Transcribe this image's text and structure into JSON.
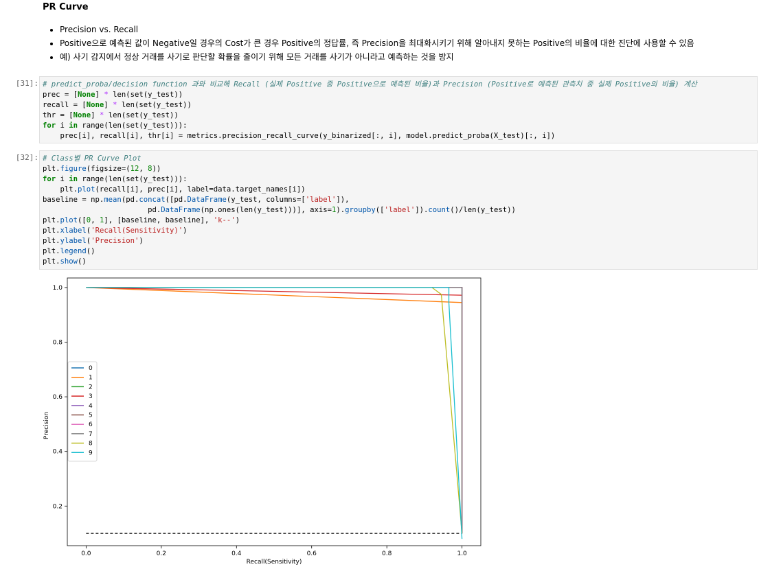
{
  "markdown": {
    "heading": "PR Curve",
    "bullets": [
      "Precision vs. Recall",
      "Positive으로 예측된 값이 Negative일 경우의 Cost가 큰 경우 Positive의 정답률, 즉 Precision을 최대화시키기 위해 알아내지 못하는 Positive의 비율에 대한 진단에 사용할 수 있음",
      "예) 사기 감지에서 정상 거래를 사기로 판단할 확률을 줄이기 위해 모든 거래를 사기가 아니라고 예측하는 것을 방지"
    ]
  },
  "cells": [
    {
      "prompt": "[31]:",
      "lines": [
        [
          [
            "cm",
            "# predict_proba/decision function 과와 비교해 Recall (실제 Positive 중 Positive으로 예측된 비율)과 Precision (Positive로 예측된 관측치 중 실제 Positive의 비율) 계산"
          ]
        ],
        [
          [
            "",
            "prec = ["
          ],
          [
            "kw",
            "None"
          ],
          [
            "",
            "] "
          ],
          [
            "op",
            "*"
          ],
          [
            "",
            " len(set(y_test))"
          ]
        ],
        [
          [
            "",
            "recall = ["
          ],
          [
            "kw",
            "None"
          ],
          [
            "",
            "] "
          ],
          [
            "op",
            "*"
          ],
          [
            "",
            " len(set(y_test))"
          ]
        ],
        [
          [
            "",
            "thr = ["
          ],
          [
            "kw",
            "None"
          ],
          [
            "",
            "] "
          ],
          [
            "op",
            "*"
          ],
          [
            "",
            " len(set(y_test))"
          ]
        ],
        [
          [
            "kw",
            "for"
          ],
          [
            "",
            " i "
          ],
          [
            "kw",
            "in"
          ],
          [
            "",
            " range(len(set(y_test))):"
          ]
        ],
        [
          [
            "",
            "    prec[i], recall[i], thr[i] = metrics.precision_recall_curve(y_binarized[:, i], model.predict_proba(X_test)[:, i])"
          ]
        ]
      ]
    },
    {
      "prompt": "[32]:",
      "lines": [
        [
          [
            "cm",
            "# Class별 PR Curve Plot"
          ]
        ],
        [
          [
            "",
            "plt."
          ],
          [
            "attr",
            "figure"
          ],
          [
            "",
            "(figsize=("
          ],
          [
            "num",
            "12"
          ],
          [
            "",
            ", "
          ],
          [
            "num",
            "8"
          ],
          [
            "",
            "))"
          ]
        ],
        [
          [
            "kw",
            "for"
          ],
          [
            "",
            " i "
          ],
          [
            "kw",
            "in"
          ],
          [
            "",
            " range(len(set(y_test))):"
          ]
        ],
        [
          [
            "",
            "    plt."
          ],
          [
            "attr",
            "plot"
          ],
          [
            "",
            "(recall[i], prec[i], label=data.target_names[i])"
          ]
        ],
        [
          [
            "",
            "baseline = np."
          ],
          [
            "attr",
            "mean"
          ],
          [
            "",
            "(pd."
          ],
          [
            "attr",
            "concat"
          ],
          [
            "",
            "([pd."
          ],
          [
            "attr",
            "DataFrame"
          ],
          [
            "",
            "(y_test, columns=["
          ],
          [
            "str",
            "'label'"
          ],
          [
            "",
            "]),"
          ]
        ],
        [
          [
            "",
            "                        pd."
          ],
          [
            "attr",
            "DataFrame"
          ],
          [
            "",
            "(np.ones(len(y_test)))], axis="
          ],
          [
            "num",
            "1"
          ],
          [
            "",
            ")."
          ],
          [
            "attr",
            "groupby"
          ],
          [
            "",
            "(["
          ],
          [
            "str",
            "'label'"
          ],
          [
            "",
            "])."
          ],
          [
            "attr",
            "count"
          ],
          [
            "",
            "()/len(y_test))"
          ]
        ],
        [
          [
            "",
            "plt."
          ],
          [
            "attr",
            "plot"
          ],
          [
            "",
            "(["
          ],
          [
            "num",
            "0"
          ],
          [
            "",
            ", "
          ],
          [
            "num",
            "1"
          ],
          [
            "",
            "], [baseline, baseline], "
          ],
          [
            "str",
            "'k--'"
          ],
          [
            "",
            ")"
          ]
        ],
        [
          [
            "",
            "plt."
          ],
          [
            "attr",
            "xlabel"
          ],
          [
            "",
            "("
          ],
          [
            "str",
            "'Recall(Sensitivity)'"
          ],
          [
            "",
            ")"
          ]
        ],
        [
          [
            "",
            "plt."
          ],
          [
            "attr",
            "ylabel"
          ],
          [
            "",
            "("
          ],
          [
            "str",
            "'Precision'"
          ],
          [
            "",
            ")"
          ]
        ],
        [
          [
            "",
            "plt."
          ],
          [
            "attr",
            "legend"
          ],
          [
            "",
            "()"
          ]
        ],
        [
          [
            "",
            "plt."
          ],
          [
            "attr",
            "show"
          ],
          [
            "",
            "()"
          ]
        ]
      ]
    }
  ],
  "chart_data": {
    "type": "line",
    "title": "",
    "xlabel": "Recall(Sensitivity)",
    "ylabel": "Precision",
    "xlim": [
      -0.05,
      1.05
    ],
    "ylim": [
      0.055,
      1.035
    ],
    "xticks": [
      "0.0",
      "0.2",
      "0.4",
      "0.6",
      "0.8",
      "1.0"
    ],
    "yticks": [
      "0.2",
      "0.4",
      "0.6",
      "0.8",
      "1.0"
    ],
    "legend_position": "center-left",
    "grid": false,
    "series": [
      {
        "name": "0",
        "color": "#1f77b4",
        "x": [
          0,
          1.0,
          1.0
        ],
        "y": [
          1.0,
          1.0,
          0.1
        ]
      },
      {
        "name": "1",
        "color": "#ff7f0e",
        "x": [
          0,
          1.0,
          1.0
        ],
        "y": [
          1.0,
          0.945,
          0.1
        ]
      },
      {
        "name": "2",
        "color": "#2ca02c",
        "x": [
          0,
          1.0,
          1.0
        ],
        "y": [
          1.0,
          1.0,
          0.1
        ]
      },
      {
        "name": "3",
        "color": "#d62728",
        "x": [
          0,
          1.0,
          1.0
        ],
        "y": [
          1.0,
          0.972,
          0.1
        ]
      },
      {
        "name": "4",
        "color": "#9467bd",
        "x": [
          0,
          1.0,
          1.0
        ],
        "y": [
          1.0,
          1.0,
          0.1
        ]
      },
      {
        "name": "5",
        "color": "#8c564b",
        "x": [
          0,
          1.0,
          1.0
        ],
        "y": [
          1.0,
          1.0,
          0.1
        ]
      },
      {
        "name": "6",
        "color": "#e377c2",
        "x": [
          0,
          1.0,
          1.0
        ],
        "y": [
          1.0,
          1.0,
          0.1
        ]
      },
      {
        "name": "7",
        "color": "#7f7f7f",
        "x": [
          0,
          1.0,
          1.0
        ],
        "y": [
          1.0,
          1.0,
          0.1
        ]
      },
      {
        "name": "8",
        "color": "#bcbd22",
        "x": [
          0,
          0.92,
          0.945,
          1.0,
          1.0
        ],
        "y": [
          1.0,
          1.0,
          0.975,
          0.1,
          0.1
        ]
      },
      {
        "name": "9",
        "color": "#17becf",
        "x": [
          0,
          0.965,
          0.965,
          1.0,
          1.0
        ],
        "y": [
          1.0,
          1.0,
          0.945,
          0.08,
          0.08
        ]
      }
    ],
    "baseline": {
      "x": [
        0,
        1
      ],
      "y": [
        0.1,
        0.1
      ],
      "style": "k--"
    }
  }
}
